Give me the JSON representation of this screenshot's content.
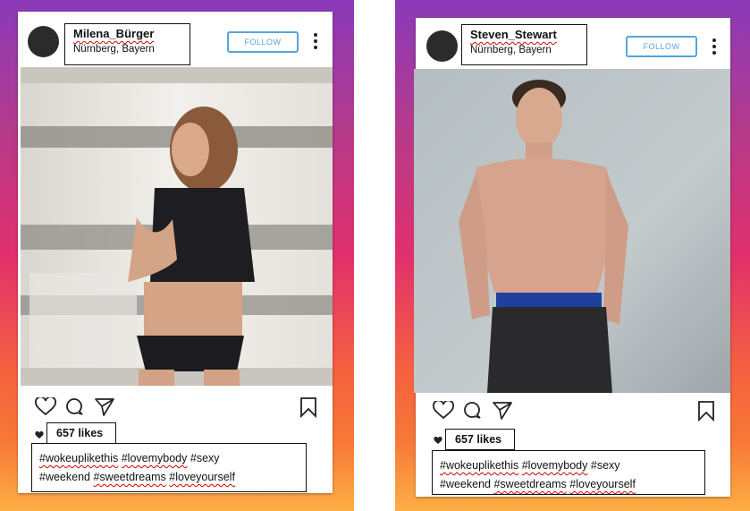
{
  "posts": [
    {
      "username": "Milena_Bürger",
      "location": "Nürnberg, Bayern",
      "follow_label": "FOLLOW",
      "likes": "657 likes",
      "tags_line1": [
        {
          "text": "#wokeuplikethis",
          "flagged": true
        },
        {
          "text": "#lovemybody",
          "flagged": true
        },
        {
          "text": "#sexy",
          "flagged": false
        }
      ],
      "tags_line2": [
        {
          "text": "#weekend",
          "flagged": false
        },
        {
          "text": "#sweetdreams",
          "flagged": true
        },
        {
          "text": "#loveyourself",
          "flagged": true
        }
      ]
    },
    {
      "username": "Steven_Stewart",
      "location": "Nürnberg, Bayern",
      "follow_label": "FOLLOW",
      "likes": "657 likes",
      "tags_line1": [
        {
          "text": "#wokeuplikethis",
          "flagged": true
        },
        {
          "text": "#lovemybody",
          "flagged": true
        },
        {
          "text": "#sexy",
          "flagged": false
        }
      ],
      "tags_line2": [
        {
          "text": "#weekend",
          "flagged": false
        },
        {
          "text": "#sweetdreams",
          "flagged": true
        },
        {
          "text": "#loveyourself",
          "flagged": true
        }
      ]
    }
  ],
  "icons": {
    "avatar": "avatar",
    "more": "more-options-icon",
    "like": "heart-outline-icon",
    "comment": "comment-bubble-icon",
    "share": "paper-plane-icon",
    "save": "bookmark-icon",
    "likes_heart": "heart-filled-icon"
  },
  "colors": {
    "follow_blue": "#53a7d8",
    "gradient": [
      "#8a3ab9",
      "#e1306c",
      "#f56040",
      "#fcaf45"
    ],
    "spellcheck_red": "#d00000"
  }
}
